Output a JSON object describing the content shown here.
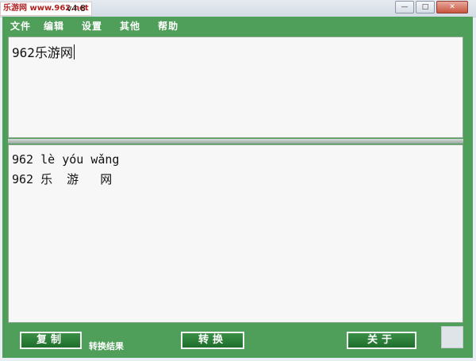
{
  "window": {
    "watermark": "乐游网 www.962.net",
    "title_suffix": "v4.8",
    "controls": {
      "minimize": "—",
      "maximize": "□",
      "close": "✕"
    }
  },
  "menu": [
    "文件",
    "编辑",
    "设置",
    "其他",
    "帮助"
  ],
  "input": {
    "value": "962乐游网"
  },
  "output": {
    "pinyin_line": "962 lè yóu wǎng",
    "hanzi_line": "962 乐  游   网"
  },
  "buttons": {
    "copy": "复制",
    "convert": "转换",
    "close": "关于"
  },
  "result_label": "转换结果",
  "colors": {
    "client_bg": "#4f9e5a",
    "button_bg": "#1f6e2c"
  }
}
